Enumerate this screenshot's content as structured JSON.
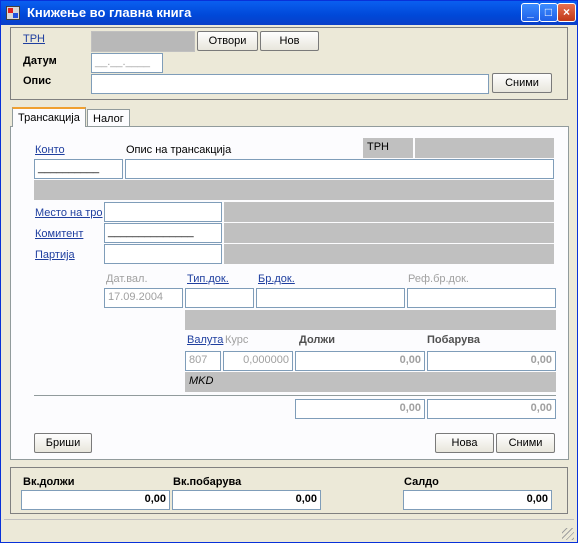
{
  "window": {
    "title": "Книжење во главна книга"
  },
  "header": {
    "trn_label": "ТРН",
    "open_label": "Отвори",
    "new_label": "Нов",
    "date_label": "Датум",
    "date_value": "__.__.____",
    "desc_label": "Опис",
    "save_label": "Сними"
  },
  "tabs": [
    "Трансакција",
    "Налог"
  ],
  "trans": {
    "konto_label": "Конто",
    "konto_value": "__________",
    "opis_label": "Опис на трансакција",
    "trn_label": "ТРН",
    "mesto_label": "Место на тро",
    "komintent_label": "Комитент",
    "komintent_value": "______________",
    "partija_label": "Партија",
    "datval_label": "Дат.вал.",
    "datval_value": "17.09.2004",
    "tipdok_label": "Тип.док.",
    "brdok_label": "Бр.док.",
    "refbrdok_label": "Реф.бр.док.",
    "valuta_label": "Валута",
    "kurs_label": "Курс",
    "dolzi_label": "Должи",
    "pobaruva_label": "Побарува",
    "valuta_value": "807",
    "kurs_value": "0,000000",
    "dolzi_value": "0,00",
    "pobaruva_value": "0,00",
    "currency_name": "MKD",
    "total_dolzi": "0,00",
    "total_pobaruva": "0,00",
    "delete_label": "Бриши",
    "new_label": "Нова",
    "save_label": "Сними"
  },
  "footer": {
    "vk_dolzi_label": "Вк.должи",
    "vk_pobaruva_label": "Вк.побарува",
    "saldo_label": "Салдо",
    "vk_dolzi": "0,00",
    "vk_pobaruva": "0,00",
    "saldo": "0,00"
  }
}
